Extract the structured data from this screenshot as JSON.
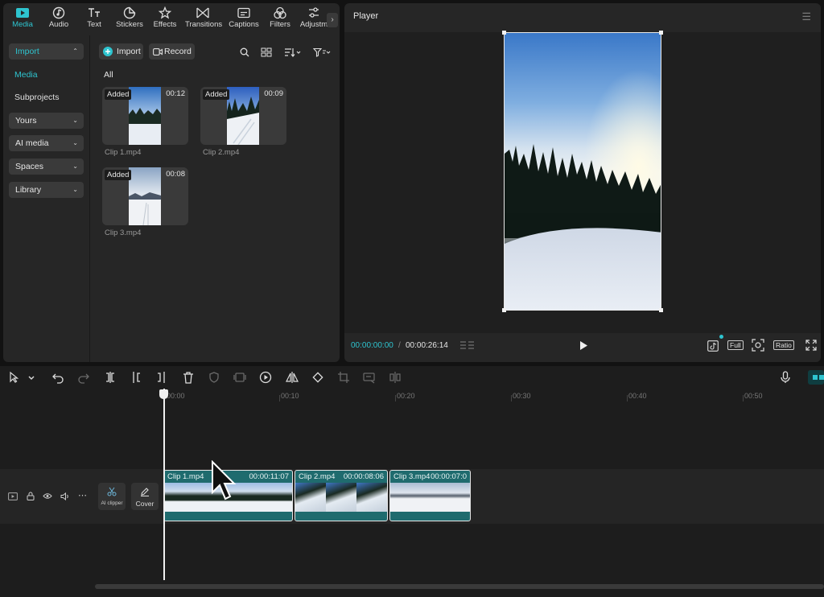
{
  "tabs": [
    {
      "label": "Media",
      "icon": "media-icon",
      "active": true
    },
    {
      "label": "Audio",
      "icon": "audio-icon"
    },
    {
      "label": "Text",
      "icon": "text-icon"
    },
    {
      "label": "Stickers",
      "icon": "stickers-icon"
    },
    {
      "label": "Effects",
      "icon": "effects-icon"
    },
    {
      "label": "Transitions",
      "icon": "transitions-icon"
    },
    {
      "label": "Captions",
      "icon": "captions-icon"
    },
    {
      "label": "Filters",
      "icon": "filters-icon"
    },
    {
      "label": "Adjustm",
      "icon": "adjustment-icon"
    }
  ],
  "sidebar": {
    "import": "Import",
    "media": "Media",
    "subprojects": "Subprojects",
    "yours": "Yours",
    "ai_media": "AI media",
    "spaces": "Spaces",
    "library": "Library"
  },
  "media": {
    "import_button": "Import",
    "record_button": "Record",
    "filter_label": "All",
    "clips": [
      {
        "name": "Clip 1.mp4",
        "badge": "Added",
        "duration": "00:12"
      },
      {
        "name": "Clip 2.mp4",
        "badge": "Added",
        "duration": "00:09"
      },
      {
        "name": "Clip 3.mp4",
        "badge": "Added",
        "duration": "00:08"
      }
    ]
  },
  "player": {
    "title": "Player",
    "current_time": "00:00:00:00",
    "separator": "/",
    "total_time": "00:00:26:14",
    "full_label": "Full",
    "ratio_label": "Ratio"
  },
  "timeline": {
    "ruler": [
      "00:00",
      "00:10",
      "00:20",
      "00:30",
      "00:40",
      "00:50"
    ],
    "ai_clipper": "AI clipper",
    "cover": "Cover",
    "clips": [
      {
        "name": "Clip 1.mp4",
        "duration": "00:00:11:07"
      },
      {
        "name": "Clip 2.mp4",
        "duration": "00:00:08:06"
      },
      {
        "name": "Clip 3.mp4",
        "duration": "00:00:07:0"
      }
    ]
  },
  "colors": {
    "accent": "#2ec4cf",
    "clip": "#1f6b6e",
    "panel": "#262626"
  }
}
